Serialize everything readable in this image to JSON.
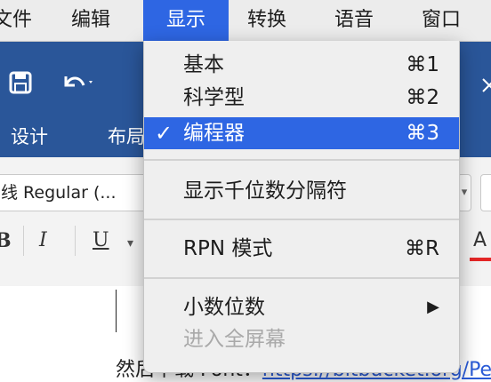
{
  "menubar": {
    "items": [
      "文件",
      "编辑",
      "显示",
      "转换",
      "语音",
      "窗口"
    ]
  },
  "app": {
    "ribbon_tabs": [
      "设计",
      "布局"
    ],
    "font_name": "线 Regular (...",
    "format_buttons": [
      "B",
      "I",
      "U",
      "A"
    ],
    "doc_text_prefix": "然后下载 Font：",
    "doc_link": "https://bitbucket.org/Pe"
  },
  "menu": {
    "items": [
      {
        "label": "基本",
        "shortcut": "⌘1"
      },
      {
        "label": "科学型",
        "shortcut": "⌘2"
      },
      {
        "label": "编程器",
        "shortcut": "⌘3",
        "check": "✓"
      },
      {
        "label": "显示千位数分隔符",
        "shortcut": ""
      },
      {
        "label": "RPN 模式",
        "shortcut": "⌘R"
      },
      {
        "label": "小数位数",
        "shortcut": "▶"
      },
      {
        "label": "进入全屏幕",
        "shortcut": ""
      }
    ]
  },
  "colors": {
    "selection": "#2e66e3",
    "ribbon": "#2a5699"
  }
}
